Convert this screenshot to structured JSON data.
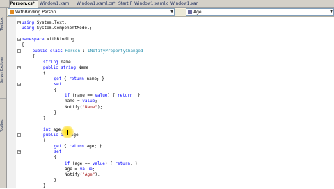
{
  "tabs": [
    {
      "label": "Person.cs*",
      "active": true
    },
    {
      "label": "Window1.xaml",
      "active": false
    },
    {
      "label": "Window1.xaml.cs*",
      "active": false
    },
    {
      "label": "Start Page",
      "active": false
    },
    {
      "label": "Window1.xaml.cs",
      "active": false
    },
    {
      "label": "Window1.xaml",
      "active": false
    }
  ],
  "side_tabs": [
    "Toolbox",
    "Server Explorer",
    "Toolbox"
  ],
  "nav": {
    "class_combo": "WithBinding.Person",
    "member_combo": "Age"
  },
  "code_lines": [
    {
      "indent": 0,
      "tokens": [
        {
          "t": "using ",
          "k": "kw"
        },
        {
          "t": "System.Text;"
        }
      ]
    },
    {
      "indent": 0,
      "tokens": [
        {
          "t": "using ",
          "k": "kw"
        },
        {
          "t": "System.ComponentModel;"
        }
      ]
    },
    {
      "indent": 0,
      "tokens": []
    },
    {
      "indent": 0,
      "tokens": [
        {
          "t": "namespace ",
          "k": "kw"
        },
        {
          "t": "WithBinding"
        }
      ]
    },
    {
      "indent": 0,
      "tokens": [
        {
          "t": "{"
        }
      ]
    },
    {
      "indent": 1,
      "tokens": [
        {
          "t": "public ",
          "k": "kw"
        },
        {
          "t": "class ",
          "k": "kw"
        },
        {
          "t": "Person",
          "k": "ty"
        },
        {
          "t": " : "
        },
        {
          "t": "INotifyPropertyChanged",
          "k": "ty"
        }
      ]
    },
    {
      "indent": 1,
      "tokens": [
        {
          "t": "{"
        }
      ]
    },
    {
      "indent": 2,
      "tokens": [
        {
          "t": "string ",
          "k": "kw"
        },
        {
          "t": "name;"
        }
      ]
    },
    {
      "indent": 2,
      "tokens": [
        {
          "t": "public ",
          "k": "kw"
        },
        {
          "t": "string ",
          "k": "kw"
        },
        {
          "t": "Name"
        }
      ]
    },
    {
      "indent": 2,
      "tokens": [
        {
          "t": "{"
        }
      ]
    },
    {
      "indent": 3,
      "tokens": [
        {
          "t": "get ",
          "k": "kw"
        },
        {
          "t": "{ "
        },
        {
          "t": "return ",
          "k": "kw"
        },
        {
          "t": "name; }"
        }
      ]
    },
    {
      "indent": 3,
      "tokens": [
        {
          "t": "set",
          "k": "kw"
        }
      ]
    },
    {
      "indent": 3,
      "tokens": [
        {
          "t": "{"
        }
      ]
    },
    {
      "indent": 4,
      "tokens": [
        {
          "t": "if ",
          "k": "kw"
        },
        {
          "t": "(name == "
        },
        {
          "t": "value",
          "k": "kw"
        },
        {
          "t": ") { "
        },
        {
          "t": "return",
          "k": "kw"
        },
        {
          "t": "; }"
        }
      ]
    },
    {
      "indent": 4,
      "tokens": [
        {
          "t": "name = "
        },
        {
          "t": "value",
          "k": "kw"
        },
        {
          "t": ";"
        }
      ]
    },
    {
      "indent": 4,
      "tokens": [
        {
          "t": "Notify("
        },
        {
          "t": "\"Name\"",
          "k": "st"
        },
        {
          "t": ");"
        }
      ]
    },
    {
      "indent": 3,
      "tokens": [
        {
          "t": "}"
        }
      ]
    },
    {
      "indent": 2,
      "tokens": [
        {
          "t": "}"
        }
      ]
    },
    {
      "indent": 0,
      "tokens": []
    },
    {
      "indent": 2,
      "tokens": [
        {
          "t": "int ",
          "k": "kw"
        },
        {
          "t": "age;"
        }
      ]
    },
    {
      "indent": 2,
      "tokens": [
        {
          "t": "public ",
          "k": "kw"
        },
        {
          "t": "int",
          "k": "kw"
        },
        {
          "t": " Age"
        }
      ]
    },
    {
      "indent": 2,
      "tokens": [
        {
          "t": "{"
        }
      ]
    },
    {
      "indent": 3,
      "tokens": [
        {
          "t": "get ",
          "k": "kw"
        },
        {
          "t": "{ "
        },
        {
          "t": "return ",
          "k": "kw"
        },
        {
          "t": "age; }"
        }
      ]
    },
    {
      "indent": 3,
      "tokens": [
        {
          "t": "set",
          "k": "kw"
        }
      ]
    },
    {
      "indent": 3,
      "tokens": [
        {
          "t": "{"
        }
      ]
    },
    {
      "indent": 4,
      "tokens": [
        {
          "t": "if ",
          "k": "kw"
        },
        {
          "t": "(age == "
        },
        {
          "t": "value",
          "k": "kw"
        },
        {
          "t": ") { "
        },
        {
          "t": "return",
          "k": "kw"
        },
        {
          "t": "; }"
        }
      ]
    },
    {
      "indent": 4,
      "tokens": [
        {
          "t": "age = "
        },
        {
          "t": "value",
          "k": "kw"
        },
        {
          "t": ";"
        }
      ]
    },
    {
      "indent": 4,
      "tokens": [
        {
          "t": "Notify("
        },
        {
          "t": "\"Age\"",
          "k": "st"
        },
        {
          "t": ");"
        }
      ]
    },
    {
      "indent": 3,
      "tokens": [
        {
          "t": "}"
        }
      ]
    },
    {
      "indent": 2,
      "tokens": [
        {
          "t": "}"
        }
      ]
    }
  ],
  "colors": {
    "keyword": "#0000ff",
    "type": "#2b91af",
    "string": "#a31515"
  }
}
